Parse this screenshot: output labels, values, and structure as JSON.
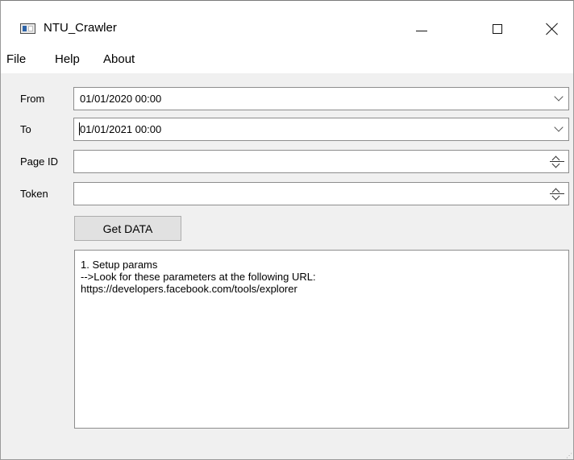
{
  "window": {
    "title": "NTU_Crawler",
    "app_icon": "window-app-icon",
    "controls": {
      "minimize": "minimize-icon",
      "maximize": "maximize-icon",
      "close": "close-icon"
    }
  },
  "menu": {
    "items": [
      "File",
      "Help",
      "About"
    ]
  },
  "form": {
    "from": {
      "label": "From",
      "value": "01/01/2020 00:00"
    },
    "to": {
      "label": "To",
      "value": "01/01/2021 00:00"
    },
    "page_id": {
      "label": "Page ID",
      "value": ""
    },
    "token": {
      "label": "Token",
      "value": ""
    },
    "get_button": "Get DATA"
  },
  "log": {
    "lines": [
      "1. Setup params",
      "-->Look for these parameters at the following URL:",
      "https://developers.facebook.com/tools/explorer"
    ]
  },
  "colors": {
    "window_bg": "#f0f0f0",
    "field_border": "#8d8d8d",
    "button_bg": "#e1e1e1"
  }
}
